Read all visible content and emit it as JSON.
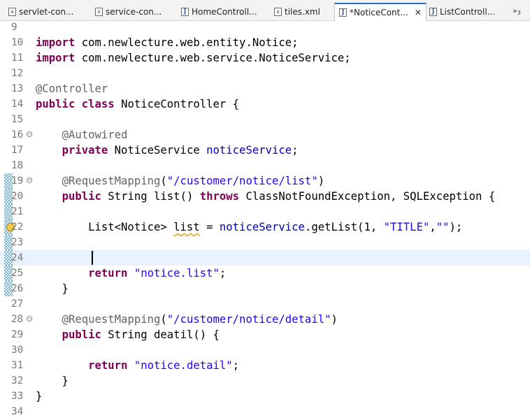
{
  "tabs": [
    {
      "label": "servlet-con...",
      "icon": "xml-file-icon",
      "active": false
    },
    {
      "label": "service-con...",
      "icon": "xml-file-icon",
      "active": false
    },
    {
      "label": "HomeControll...",
      "icon": "java-file-icon",
      "active": false
    },
    {
      "label": "tiles.xml",
      "icon": "xml-file-icon",
      "active": false
    },
    {
      "label": "*NoticeCont...",
      "icon": "java-file-icon",
      "active": true
    },
    {
      "label": "ListControll...",
      "icon": "java-file-icon",
      "active": false
    }
  ],
  "tab_close_glyph": "✕",
  "tab_overflow": {
    "glyph": "»",
    "count": "3"
  },
  "editor": {
    "current_line": 24,
    "colors": {
      "keyword": "#7f0055",
      "annotation": "#646464",
      "string": "#2a00ff",
      "field": "#0000c0",
      "current_line_bg": "#e8f2fe",
      "change_marker": "#7fb3c6"
    },
    "lines": [
      {
        "n": "9",
        "tokens": []
      },
      {
        "n": "10",
        "tokens": [
          [
            "kw",
            "import"
          ],
          [
            "",
            " com.newlecture.web.entity.Notice;"
          ]
        ]
      },
      {
        "n": "11",
        "tokens": [
          [
            "kw",
            "import"
          ],
          [
            "",
            " com.newlecture.web.service.NoticeService;"
          ]
        ]
      },
      {
        "n": "12",
        "tokens": []
      },
      {
        "n": "13",
        "tokens": [
          [
            "ann",
            "@Controller"
          ]
        ]
      },
      {
        "n": "14",
        "tokens": [
          [
            "kw",
            "public"
          ],
          [
            "",
            " "
          ],
          [
            "kw",
            "class"
          ],
          [
            "",
            " NoticeController {"
          ]
        ]
      },
      {
        "n": "15",
        "tokens": []
      },
      {
        "n": "16",
        "fold": true,
        "tokens": [
          [
            "",
            "    "
          ],
          [
            "ann",
            "@Autowired"
          ]
        ]
      },
      {
        "n": "17",
        "tokens": [
          [
            "",
            "    "
          ],
          [
            "kw",
            "private"
          ],
          [
            "",
            " NoticeService "
          ],
          [
            "fld",
            "noticeService"
          ],
          [
            "",
            ";"
          ]
        ]
      },
      {
        "n": "18",
        "tokens": []
      },
      {
        "n": "19",
        "fold": true,
        "changed": true,
        "tokens": [
          [
            "",
            "    "
          ],
          [
            "ann",
            "@RequestMapping"
          ],
          [
            "",
            "("
          ],
          [
            "str",
            "\"/customer/notice/list\""
          ],
          [
            "",
            ")"
          ]
        ]
      },
      {
        "n": "20",
        "changed": true,
        "tokens": [
          [
            "",
            "    "
          ],
          [
            "kw",
            "public"
          ],
          [
            "",
            " String list() "
          ],
          [
            "kw",
            "throws"
          ],
          [
            "",
            " ClassNotFoundException, SQLException {"
          ]
        ]
      },
      {
        "n": "21",
        "changed": true,
        "tokens": []
      },
      {
        "n": "22",
        "changed": true,
        "warning": true,
        "tokens": [
          [
            "",
            "        List<Notice> "
          ],
          [
            "warnword",
            "list"
          ],
          [
            "",
            " = "
          ],
          [
            "fld",
            "noticeService"
          ],
          [
            "",
            ".getList(1, "
          ],
          [
            "str",
            "\"TITLE\""
          ],
          [
            "",
            ","
          ],
          [
            "str",
            "\"\""
          ],
          [
            "",
            ");"
          ]
        ]
      },
      {
        "n": "23",
        "changed": true,
        "tokens": []
      },
      {
        "n": "24",
        "changed": true,
        "tokens": []
      },
      {
        "n": "25",
        "changed": true,
        "tokens": [
          [
            "",
            "        "
          ],
          [
            "kw",
            "return"
          ],
          [
            "",
            " "
          ],
          [
            "str",
            "\"notice.list\""
          ],
          [
            "",
            ";"
          ]
        ]
      },
      {
        "n": "26",
        "changed": true,
        "tokens": [
          [
            "",
            "    }"
          ]
        ]
      },
      {
        "n": "27",
        "tokens": []
      },
      {
        "n": "28",
        "fold": true,
        "tokens": [
          [
            "",
            "    "
          ],
          [
            "ann",
            "@RequestMapping"
          ],
          [
            "",
            "("
          ],
          [
            "str",
            "\"/customer/notice/detail\""
          ],
          [
            "",
            ")"
          ]
        ]
      },
      {
        "n": "29",
        "tokens": [
          [
            "",
            "    "
          ],
          [
            "kw",
            "public"
          ],
          [
            "",
            " String deatil() {"
          ]
        ]
      },
      {
        "n": "30",
        "tokens": []
      },
      {
        "n": "31",
        "tokens": [
          [
            "",
            "        "
          ],
          [
            "kw",
            "return"
          ],
          [
            "",
            " "
          ],
          [
            "str",
            "\"notice.detail\""
          ],
          [
            "",
            ";"
          ]
        ]
      },
      {
        "n": "32",
        "tokens": [
          [
            "",
            "    }"
          ]
        ]
      },
      {
        "n": "33",
        "tokens": [
          [
            "",
            "}"
          ]
        ]
      },
      {
        "n": "34",
        "tokens": []
      }
    ]
  }
}
